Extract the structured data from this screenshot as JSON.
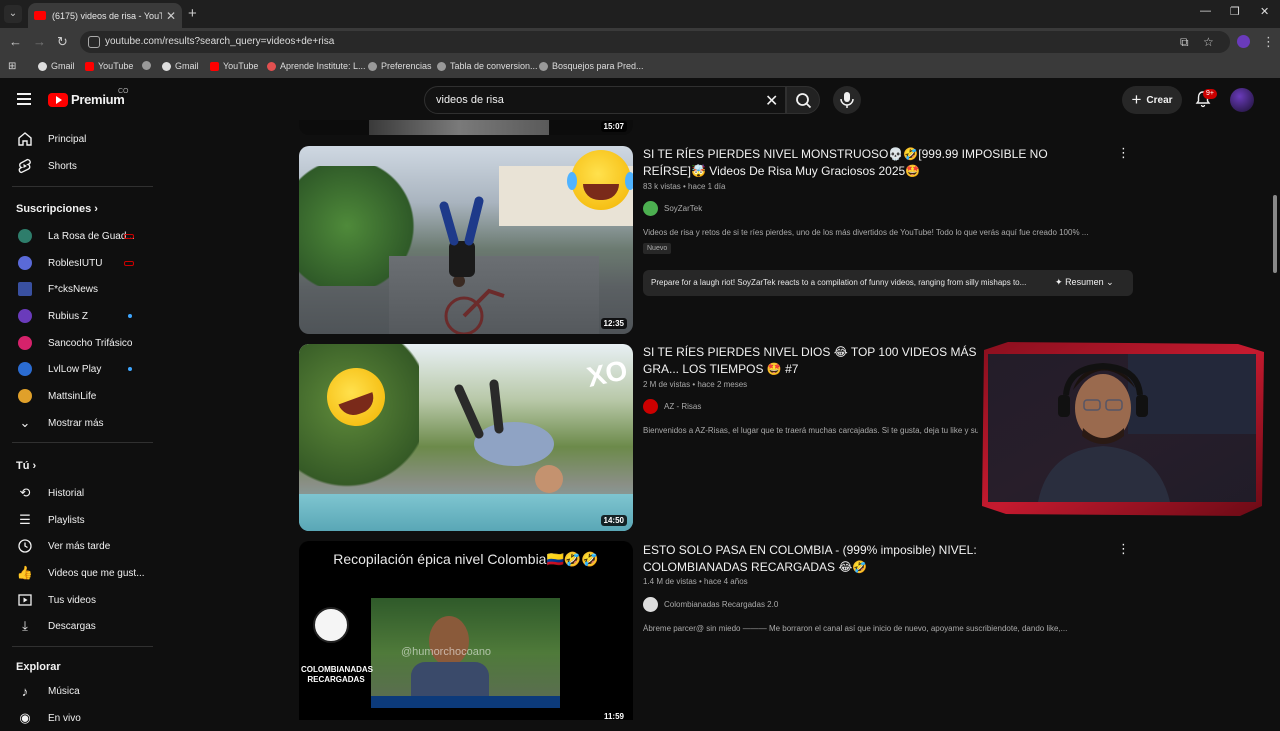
{
  "browser": {
    "tab_title": "(6175) videos de risa - YouTube",
    "url": "youtube.com/results?search_query=videos+de+risa",
    "bookmarks": [
      "Gmail",
      "YouTube",
      "Gmail",
      "YouTube",
      "Aprende Institute: L...",
      "Preferencias",
      "Tabla de conversion...",
      "Bosquejos para Pred..."
    ]
  },
  "header": {
    "logo": "Premium",
    "logo_country": "CO",
    "search_query": "videos de risa",
    "create_label": "Crear",
    "notif_badge": "9+"
  },
  "sidebar": {
    "main": [
      {
        "label": "Principal",
        "icon": "home-icon"
      },
      {
        "label": "Shorts",
        "icon": "shorts-icon"
      }
    ],
    "subscriptions_title": "Suscripciones",
    "subscriptions": [
      {
        "label": "La Rosa de Guad...",
        "color": "#2e7d6b",
        "indicator": "live"
      },
      {
        "label": "RoblesIUTU",
        "color": "#5a6ad8",
        "indicator": "live"
      },
      {
        "label": "F*cksNews",
        "color": "#3950a0",
        "indicator": ""
      },
      {
        "label": "Rubius Z",
        "color": "#6a3bbb",
        "indicator": "new"
      },
      {
        "label": "Sancocho Trifásico",
        "color": "#d6226b",
        "indicator": ""
      },
      {
        "label": "LvlLow Play",
        "color": "#2b6cd1",
        "indicator": "new"
      },
      {
        "label": "MattsinLife",
        "color": "#e0a02a",
        "indicator": ""
      }
    ],
    "show_more": "Mostrar más",
    "you_title": "Tú",
    "you_items": [
      {
        "label": "Historial",
        "icon": "history-icon"
      },
      {
        "label": "Playlists",
        "icon": "playlist-icon"
      },
      {
        "label": "Ver más tarde",
        "icon": "clock-icon"
      },
      {
        "label": "Videos que me gust...",
        "icon": "thumbs-up-icon"
      },
      {
        "label": "Tus videos",
        "icon": "your-videos-icon"
      },
      {
        "label": "Descargas",
        "icon": "download-icon"
      }
    ],
    "explore_title": "Explorar",
    "explore_items": [
      {
        "label": "Música",
        "icon": "music-icon"
      },
      {
        "label": "En vivo",
        "icon": "live-icon"
      }
    ]
  },
  "results": {
    "top_duration": "15:07",
    "videos": [
      {
        "title": "SI TE RÍES PIERDES NIVEL MONSTRUOSO💀🤣[999.99 IMPOSIBLE NO REÍRSE]🤯 Videos De Risa Muy Graciosos 2025🤩",
        "meta": "83 k vistas • hace 1 día",
        "channel": "SoyZarTek",
        "channel_color": "#4caf50",
        "description": "Videos de risa y retos de si te ríes pierdes, uno de los más divertidos de YouTube! Todo lo que verás aquí fue creado 100% ...",
        "badge": "Nuevo",
        "summary": "Prepare for a laugh riot! SoyZarTek reacts to a compilation of funny videos, ranging from silly mishaps to...",
        "summary_label": "Resumen",
        "duration": "12:35"
      },
      {
        "title": "SI TE RÍES PIERDES NIVEL DIOS 😂 TOP 100 VIDEOS MÁS GRA... LOS TIEMPOS 🤩 #7",
        "meta": "2 M de vistas • hace 2 meses",
        "channel": "AZ - Risas",
        "channel_color": "#cc0000",
        "description": "Bienvenidos a AZ-Risas, el lugar que te traerá muchas carcajadas. Si te gusta, deja tu like y suscr...",
        "duration": "14:50"
      },
      {
        "title": "ESTO SOLO PASA EN COLOMBIA - (999% imposible) NIVEL: COLOMBIANADAS RECARGADAS 😂🤣",
        "meta": "1.4 M de vistas • hace 4 años",
        "channel": "Colombianadas Recargadas 2.0",
        "channel_color": "#dddddd",
        "description": "Ábreme parcer@ sin miedo ——— Me borraron el canal así que inicio de nuevo, apoyame suscribiendote, dando like,...",
        "duration": "11:59",
        "thumb_text": "Recopilación épica nivel Colombia🇨🇴🤣🤣",
        "thumb_brand": "COLOMBIANADAS RECARGADAS",
        "thumb_watermark": "@humorchocoano"
      }
    ]
  }
}
